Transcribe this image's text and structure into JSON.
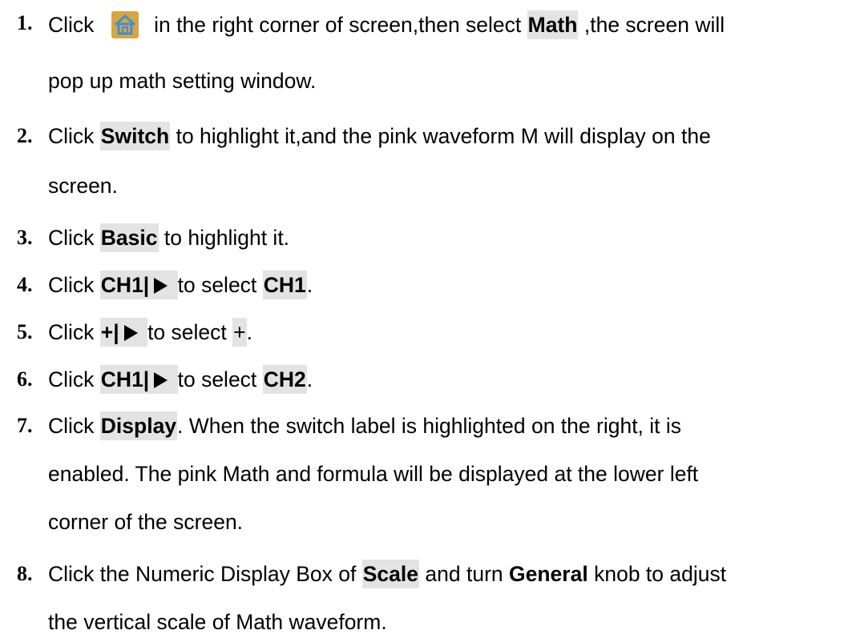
{
  "steps": [
    {
      "num": "1.",
      "l1": {
        "a": "Click",
        "b": "in the right corner of screen,then select",
        "kw": "Math",
        "c": ",the screen will"
      },
      "l2": "pop up math setting window.",
      "icon": "home-icon"
    },
    {
      "num": "2.",
      "l1": {
        "a": "Click",
        "kw": "Switch",
        "b": "to highlight it,and the pink waveform M will display on the"
      },
      "l2": "screen."
    },
    {
      "num": "3.",
      "l1": {
        "a": "Click",
        "kw": "Basic",
        "b": "to highlight it."
      }
    },
    {
      "num": "4.",
      "l1": {
        "a": "Click",
        "kw": "CH1|",
        "b": "to select",
        "kw2": "CH1",
        "c": "."
      }
    },
    {
      "num": "5.",
      "l1": {
        "a": "Click",
        "kw": "+|",
        "b": "to select",
        "kw2": "+",
        "c": "."
      }
    },
    {
      "num": "6.",
      "l1": {
        "a": "Click",
        "kw": "CH1|",
        "b": "to select",
        "kw2": "CH2",
        "c": "."
      }
    },
    {
      "num": "7.",
      "l1": {
        "a": "Click",
        "kw": "Display",
        "b": ". When the switch label is highlighted on the right, it is"
      },
      "l2": "enabled. The pink Math and formula will be displayed at the lower left",
      "l3": "corner of the screen."
    },
    {
      "num": "8.",
      "l1": {
        "a": "Click the Numeric Display Box of",
        "kw": "Scale",
        "b": "and turn",
        "kw2": "General",
        "c": "knob to adjust"
      },
      "l2": "the vertical scale of Math waveform."
    }
  ],
  "colors": {
    "highlight": "#e3e3e3",
    "icon_bg": "#d9a441",
    "icon_fg": "#3d8fd6"
  },
  "icons": {
    "play": "play-triangle-icon",
    "home": "home-icon"
  }
}
